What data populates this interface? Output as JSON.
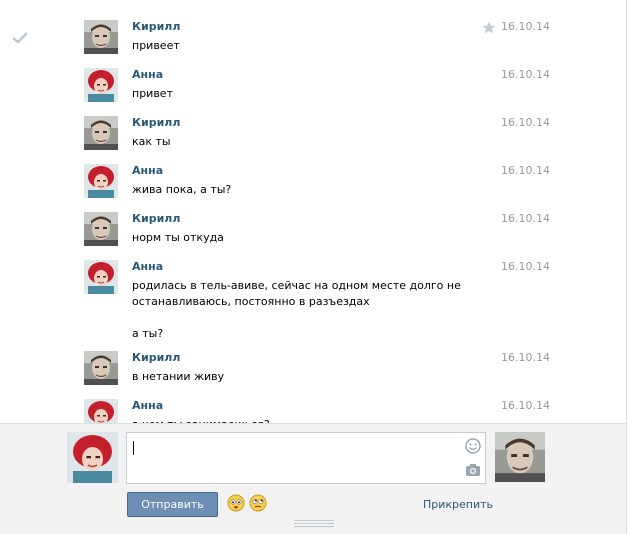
{
  "messages": [
    {
      "author": "Кирилл",
      "avatar": "kirill",
      "date": "16.10.14",
      "lines": [
        "привеет"
      ],
      "read_check": true,
      "star": true
    },
    {
      "author": "Анна",
      "avatar": "anna",
      "date": "16.10.14",
      "lines": [
        "привет"
      ]
    },
    {
      "author": "Кирилл",
      "avatar": "kirill",
      "date": "16.10.14",
      "lines": [
        "как ты"
      ]
    },
    {
      "author": "Анна",
      "avatar": "anna",
      "date": "16.10.14",
      "lines": [
        "жива пока, а ты?"
      ]
    },
    {
      "author": "Кирилл",
      "avatar": "kirill",
      "date": "16.10.14",
      "lines": [
        "норм ты откуда"
      ]
    },
    {
      "author": "Анна",
      "avatar": "anna",
      "date": "16.10.14",
      "lines": [
        "родилась в тель-авиве, сейчас на одном месте долго не",
        "останавливаюсь, постоянно в разъездах",
        "",
        "а ты?"
      ]
    },
    {
      "author": "Кирилл",
      "avatar": "kirill",
      "date": "16.10.14",
      "lines": [
        "в нетании живу"
      ]
    },
    {
      "author": "Анна",
      "avatar": "anna",
      "date": "16.10.14",
      "lines": [
        "а чем ты занимаешься?"
      ]
    }
  ],
  "compose": {
    "send_label": "Отправить",
    "attach_label": "Прикрепить",
    "input_value": "",
    "icons": {
      "smile": "smile-icon",
      "camera": "camera-icon",
      "check": "check-icon",
      "star": "star-icon"
    }
  },
  "colors": {
    "author": "#2b587a",
    "date": "#999999",
    "button": "#6d8fb3",
    "compose_bg": "#f2f2f2"
  }
}
